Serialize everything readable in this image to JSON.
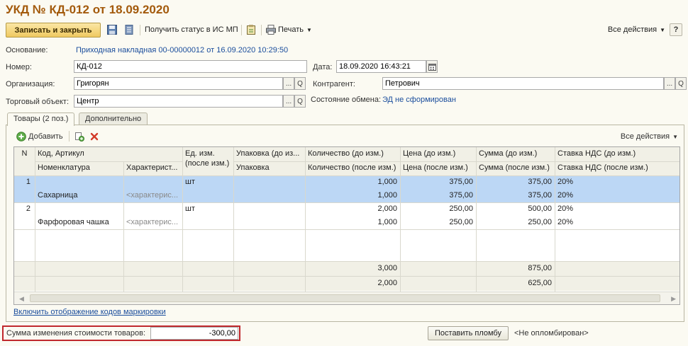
{
  "document": {
    "title": "УКД № КД-012 от 18.09.2020"
  },
  "toolbar": {
    "save_close": "Записать и закрыть",
    "get_status": "Получить статус в ИС МП",
    "print": "Печать",
    "all_actions": "Все действия",
    "help": "?"
  },
  "form": {
    "basis_label": "Основание:",
    "basis_value": "Приходная накладная 00-00000012 от 16.09.2020 10:29:50",
    "number_label": "Номер:",
    "number_value": "КД-012",
    "date_label": "Дата:",
    "date_value": "18.09.2020 16:43:21",
    "org_label": "Организация:",
    "org_value": "Григорян",
    "counterparty_label": "Контрагент:",
    "counterparty_value": "Петрович",
    "store_label": "Торговый объект:",
    "store_value": "Центр",
    "exchange_label": "Состояние обмена:",
    "exchange_value": "ЭД не сформирован",
    "choose_glyph": "...",
    "open_glyph": "Q"
  },
  "tabs": [
    {
      "label": "Товары (2 поз.)"
    },
    {
      "label": "Дополнительно"
    }
  ],
  "table_toolbar": {
    "add": "Добавить",
    "all_actions": "Все действия"
  },
  "table": {
    "headers_top": [
      "N",
      "Код, Артикул",
      "Ед. изм. (после изм.)",
      "Упаковка (до изм.)",
      "Количество (до изм.)",
      "Цена (до изм.)",
      "Сумма (до изм.)",
      "Ставка НДС (до изм.)"
    ],
    "headers_bottom": [
      "Номенклатура",
      "Характеристика",
      "Упаковка",
      "Количество (после изм.)",
      "Цена (после изм.)",
      "Сумма (после изм.)",
      "Ставка НДС (после изм.)"
    ],
    "header_char_display": "Характерист...",
    "header_ed": [
      "Ед. изм.",
      "(после изм.)"
    ],
    "header_pack_top": "Упаковка (до из...",
    "rows": [
      {
        "n": "1",
        "name": "Сахарница",
        "characteristic": "<характерис...",
        "unit": "шт",
        "qty_before": "1,000",
        "qty_after": "1,000",
        "price_before": "375,00",
        "price_after": "375,00",
        "sum_before": "375,00",
        "sum_after": "375,00",
        "vat_before": "20%",
        "vat_after": "20%"
      },
      {
        "n": "2",
        "name": "Фарфоровая чашка",
        "characteristic": "<характерис...",
        "unit": "шт",
        "qty_before": "2,000",
        "qty_after": "1,000",
        "price_before": "250,00",
        "price_after": "250,00",
        "sum_before": "500,00",
        "sum_after": "250,00",
        "vat_before": "20%",
        "vat_after": "20%"
      }
    ],
    "totals": {
      "qty_before": "3,000",
      "qty_after": "2,000",
      "sum_before": "875,00",
      "sum_after": "625,00"
    }
  },
  "marking_link": "Включить отображение кодов маркировки",
  "footer": {
    "sum_change_label": "Сумма изменения стоимости товаров:",
    "sum_change_value": "-300,00",
    "seal_button": "Поставить пломбу",
    "seal_status": "<Не опломбирован>"
  },
  "colors": {
    "title": "#a35a0c",
    "link": "#1a4d9c",
    "selection": "#bcd7f5",
    "highlight_border": "#c0282d"
  }
}
